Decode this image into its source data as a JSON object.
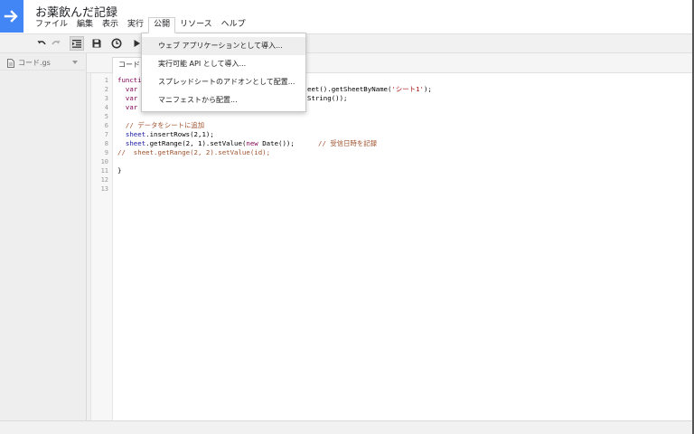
{
  "doc_title": "お薬飲んだ記録",
  "menubar": {
    "items": [
      "ファイル",
      "編集",
      "表示",
      "実行",
      "公開",
      "リソース",
      "ヘルプ"
    ],
    "open_index": 4
  },
  "publish_menu": {
    "items": [
      "ウェブ アプリケーションとして導入...",
      "実行可能 API として導入...",
      "スプレッドシートのアドオンとして配置...",
      "マニフェストから配置..."
    ]
  },
  "sidebar": {
    "file_name": "コード.gs"
  },
  "editor": {
    "tab_label": "コード",
    "line_numbers": [
      "1",
      "2",
      "3",
      "4",
      "5",
      "6",
      "7",
      "8",
      "9",
      "10",
      "11",
      "12",
      "13"
    ]
  },
  "code": {
    "l1": "functi",
    "l2_a": "  var",
    "l2_b": "eet().getSheetByName(",
    "l2_str": "'シート1'",
    "l2_c": ");",
    "l3_a": "  var",
    "l3_b": "String());",
    "l4_a": "  var",
    "l6": "  // データをシートに追加",
    "l7_a": "  sheet",
    "l7_b": ".insertRows(2,1);",
    "l8_a": "  sheet",
    "l8_b": ".getRange(2, 1).setValue(",
    "l8_kw": "new",
    "l8_c": " Date());",
    "l8_cmt": "// 受信日時を記録",
    "l9": "//  sheet.getRange(2, 2).setValue(id);",
    "l11": "}"
  },
  "colors": {
    "brand": "#4285f4",
    "comment": "#a0522d",
    "keyword": "#7f0055",
    "string": "#aa1111"
  },
  "icons": [
    "apps-script-arrow-icon",
    "undo-icon",
    "redo-icon",
    "indent-icon",
    "save-icon",
    "triggers-icon",
    "run-icon",
    "file-icon"
  ]
}
